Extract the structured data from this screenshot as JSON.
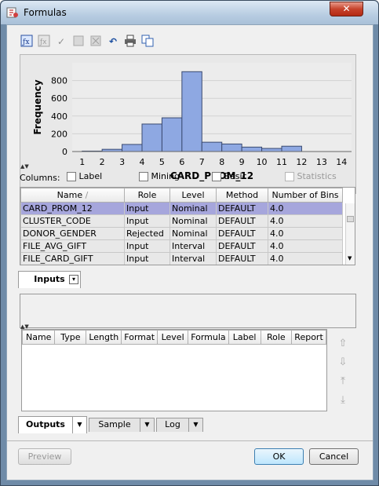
{
  "window": {
    "title": "Formulas",
    "close_label": "✕"
  },
  "toolbar": {
    "icons": [
      "formula-builder-icon",
      "cancel-formula-icon",
      "check-icon",
      "delete-icon",
      "clear-icon",
      "undo-icon",
      "print-icon",
      "copy-icon"
    ]
  },
  "chart_data": {
    "type": "bar",
    "xlabel": "CARD_PROM_12",
    "ylabel": "Frequency",
    "ylim": [
      0,
      1000
    ],
    "yticks": [
      0,
      200,
      400,
      600,
      800
    ],
    "xticks": [
      1,
      2,
      3,
      4,
      5,
      6,
      7,
      8,
      9,
      10,
      11,
      12,
      13,
      14
    ],
    "bins": [
      {
        "from": 1.0,
        "to": 2.0,
        "value": 5
      },
      {
        "from": 2.0,
        "to": 3.0,
        "value": 25
      },
      {
        "from": 3.0,
        "to": 4.0,
        "value": 80
      },
      {
        "from": 4.0,
        "to": 5.0,
        "value": 310
      },
      {
        "from": 5.0,
        "to": 6.0,
        "value": 380
      },
      {
        "from": 6.0,
        "to": 7.0,
        "value": 900
      },
      {
        "from": 7.0,
        "to": 8.0,
        "value": 105
      },
      {
        "from": 8.0,
        "to": 9.0,
        "value": 85
      },
      {
        "from": 9.0,
        "to": 10.0,
        "value": 50
      },
      {
        "from": 10.0,
        "to": 11.0,
        "value": 35
      },
      {
        "from": 11.0,
        "to": 12.0,
        "value": 60
      }
    ],
    "grid": true
  },
  "columns": {
    "label": "Columns:",
    "options": [
      {
        "label": "Label",
        "checked": false,
        "enabled": true
      },
      {
        "label": "Mining",
        "checked": false,
        "enabled": true
      },
      {
        "label": "Basic",
        "checked": false,
        "enabled": true
      },
      {
        "label": "Statistics",
        "checked": false,
        "enabled": false
      }
    ]
  },
  "inputs_table": {
    "headers": [
      "Name",
      "Role",
      "Level",
      "Method",
      "Number of Bins"
    ],
    "rows": [
      [
        "CARD_PROM_12",
        "Input",
        "Nominal",
        "DEFAULT",
        "4.0"
      ],
      [
        "CLUSTER_CODE",
        "Input",
        "Nominal",
        "DEFAULT",
        "4.0"
      ],
      [
        "DONOR_GENDER",
        "Rejected",
        "Nominal",
        "DEFAULT",
        "4.0"
      ],
      [
        "FILE_AVG_GIFT",
        "Input",
        "Interval",
        "DEFAULT",
        "4.0"
      ],
      [
        "FILE_CARD_GIFT",
        "Input",
        "Interval",
        "DEFAULT",
        "4.0"
      ]
    ],
    "selected_row": 0
  },
  "tabs_top": {
    "inputs": "Inputs"
  },
  "outputs_table": {
    "headers": [
      "Name",
      "Type",
      "Length",
      "Format",
      "Level",
      "Formula",
      "Label",
      "Role",
      "Report"
    ]
  },
  "tabs_bottom": {
    "outputs": "Outputs",
    "sample": "Sample",
    "log": "Log"
  },
  "buttons": {
    "preview": "Preview",
    "ok": "OK",
    "cancel": "Cancel"
  }
}
